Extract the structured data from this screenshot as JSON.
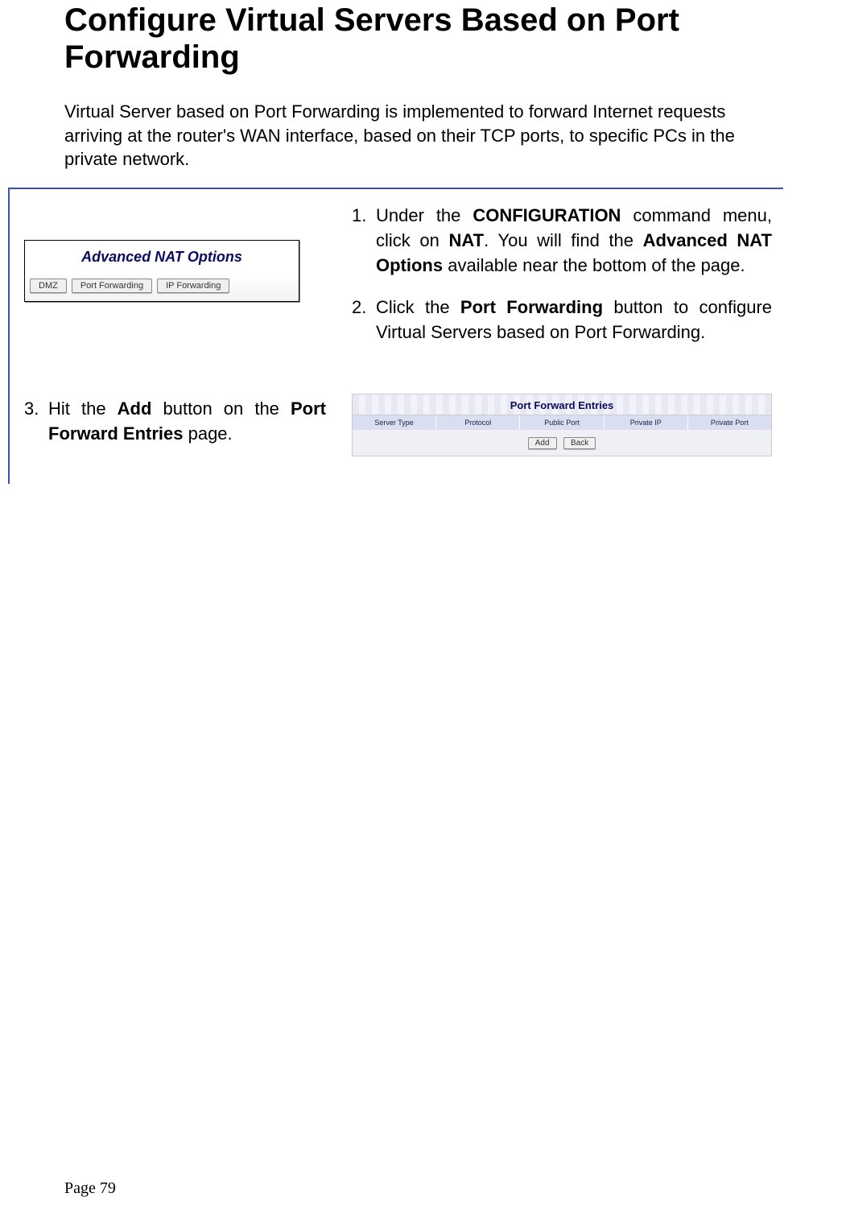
{
  "title": "Configure Virtual Servers Based on Port Forwarding",
  "intro": "Virtual Server based on Port Forwarding is implemented to forward Internet requests arriving at the router's WAN interface, based on their TCP ports, to specific PCs in the private network.",
  "nat_panel": {
    "heading": "Advanced NAT Options",
    "buttons": {
      "dmz": "DMZ",
      "pf": "Port Forwarding",
      "ipf": "IP Forwarding"
    }
  },
  "steps": {
    "s1_num": "1.",
    "s1_a": "Under the ",
    "s1_b": "CONFIGURATION",
    "s1_c": " command menu, click on ",
    "s1_d": "NAT",
    "s1_e": ". You will find the ",
    "s1_f": "Advanced NAT Options",
    "s1_g": " available near the bottom of the page.",
    "s2_num": "2.",
    "s2_a": "Click the ",
    "s2_b": "Port Forwarding",
    "s2_c": " button to configure Virtual Servers based on Port Forwarding.",
    "s3_num": "3.",
    "s3_a": "Hit the ",
    "s3_b": "Add",
    "s3_c": " button on the ",
    "s3_d": "Port Forward Entries",
    "s3_e": " page."
  },
  "pf_panel": {
    "title": "Port Forward Entries",
    "cols": {
      "c1": "Server Type",
      "c2": "Protocol",
      "c3": "Public Port",
      "c4": "Private IP",
      "c5": "Private Port"
    },
    "actions": {
      "add": "Add",
      "back": "Back"
    }
  },
  "page_number": "Page 79"
}
